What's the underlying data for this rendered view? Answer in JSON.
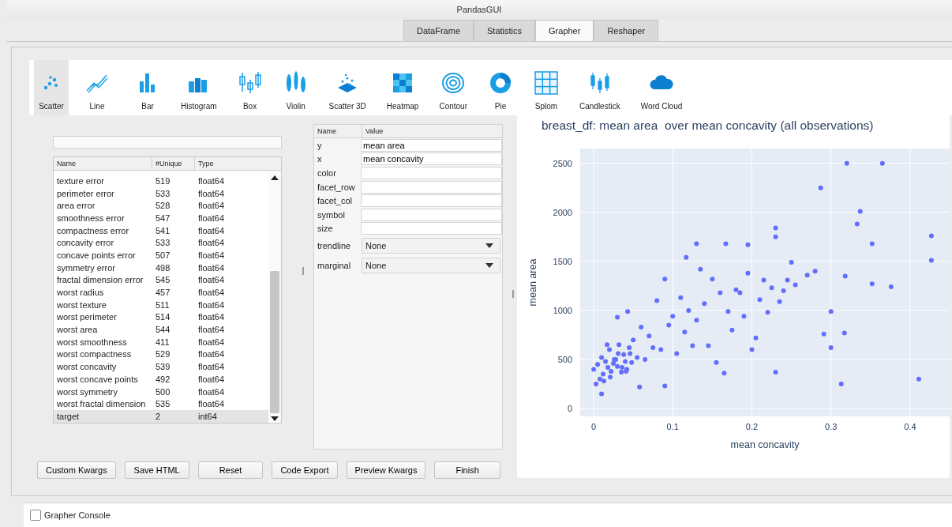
{
  "window": {
    "title": "PandasGUI"
  },
  "tabs": [
    {
      "label": "DataFrame",
      "selected": false
    },
    {
      "label": "Statistics",
      "selected": false
    },
    {
      "label": "Grapher",
      "selected": true
    },
    {
      "label": "Reshaper",
      "selected": false
    }
  ],
  "plot_types": [
    {
      "label": "Scatter",
      "selected": true
    },
    {
      "label": "Line",
      "selected": false
    },
    {
      "label": "Bar",
      "selected": false
    },
    {
      "label": "Histogram",
      "selected": false
    },
    {
      "label": "Box",
      "selected": false
    },
    {
      "label": "Violin",
      "selected": false
    },
    {
      "label": "Scatter 3D",
      "selected": false
    },
    {
      "label": "Heatmap",
      "selected": false
    },
    {
      "label": "Contour",
      "selected": false
    },
    {
      "label": "Pie",
      "selected": false
    },
    {
      "label": "Splom",
      "selected": false
    },
    {
      "label": "Candlestick",
      "selected": false
    },
    {
      "label": "Word Cloud",
      "selected": false
    }
  ],
  "columns_table": {
    "columns": [
      "Name",
      "#Unique",
      "Type"
    ],
    "rows": [
      {
        "name": "texture error",
        "unique": "519",
        "type": "float64",
        "selected": false
      },
      {
        "name": "perimeter error",
        "unique": "533",
        "type": "float64",
        "selected": false
      },
      {
        "name": "area error",
        "unique": "528",
        "type": "float64",
        "selected": false
      },
      {
        "name": "smoothness error",
        "unique": "547",
        "type": "float64",
        "selected": false
      },
      {
        "name": "compactness error",
        "unique": "541",
        "type": "float64",
        "selected": false
      },
      {
        "name": "concavity error",
        "unique": "533",
        "type": "float64",
        "selected": false
      },
      {
        "name": "concave points error",
        "unique": "507",
        "type": "float64",
        "selected": false
      },
      {
        "name": "symmetry error",
        "unique": "498",
        "type": "float64",
        "selected": false
      },
      {
        "name": "fractal dimension error",
        "unique": "545",
        "type": "float64",
        "selected": false
      },
      {
        "name": "worst radius",
        "unique": "457",
        "type": "float64",
        "selected": false
      },
      {
        "name": "worst texture",
        "unique": "511",
        "type": "float64",
        "selected": false
      },
      {
        "name": "worst perimeter",
        "unique": "514",
        "type": "float64",
        "selected": false
      },
      {
        "name": "worst area",
        "unique": "544",
        "type": "float64",
        "selected": false
      },
      {
        "name": "worst smoothness",
        "unique": "411",
        "type": "float64",
        "selected": false
      },
      {
        "name": "worst compactness",
        "unique": "529",
        "type": "float64",
        "selected": false
      },
      {
        "name": "worst concavity",
        "unique": "539",
        "type": "float64",
        "selected": false
      },
      {
        "name": "worst concave points",
        "unique": "492",
        "type": "float64",
        "selected": false
      },
      {
        "name": "worst symmetry",
        "unique": "500",
        "type": "float64",
        "selected": false
      },
      {
        "name": "worst fractal dimension",
        "unique": "535",
        "type": "float64",
        "selected": false
      },
      {
        "name": "target",
        "unique": "2",
        "type": "int64",
        "selected": true
      }
    ]
  },
  "kwargs_table": {
    "columns": [
      "Name",
      "Value"
    ],
    "rows": [
      {
        "name": "y",
        "value": "mean area",
        "kind": "text"
      },
      {
        "name": "x",
        "value": "mean concavity",
        "kind": "text"
      },
      {
        "name": "color",
        "kind": "text"
      },
      {
        "name": "facet_row",
        "kind": "text"
      },
      {
        "name": "facet_col",
        "kind": "text"
      },
      {
        "name": "symbol",
        "kind": "text"
      },
      {
        "name": "size",
        "kind": "text"
      },
      {
        "name": "trendline",
        "value": "None",
        "kind": "dropdown"
      },
      {
        "name": "marginal",
        "value": "None",
        "kind": "dropdown"
      }
    ]
  },
  "chart": {
    "chart_data": {
      "type": "scatter",
      "title": "breast_df: mean area  over mean concavity (all observations)",
      "xlabel": "mean concavity",
      "ylabel": "mean area",
      "x": [
        0,
        0.005,
        0.01,
        0.012,
        0.015,
        0.018,
        0.02,
        0.022,
        0.025,
        0.028,
        0.03,
        0.032,
        0.035,
        0.038,
        0.04,
        0.042,
        0.045,
        0.048,
        0.05,
        0.055,
        0.003,
        0.008,
        0.013,
        0.017,
        0.021,
        0.026,
        0.031,
        0.036,
        0.041,
        0.046,
        0.06,
        0.065,
        0.07,
        0.075,
        0.08,
        0.085,
        0.09,
        0.095,
        0.1,
        0.105,
        0.11,
        0.115,
        0.12,
        0.125,
        0.13,
        0.135,
        0.14,
        0.145,
        0.15,
        0.155,
        0.16,
        0.165,
        0.17,
        0.175,
        0.18,
        0.185,
        0.19,
        0.195,
        0.2,
        0.205,
        0.21,
        0.215,
        0.22,
        0.225,
        0.23,
        0.235,
        0.24,
        0.245,
        0.25,
        0.255,
        0.27,
        0.28,
        0.287,
        0.291,
        0.3,
        0.3,
        0.313,
        0.317,
        0.318,
        0.32,
        0.333,
        0.337,
        0.352,
        0.352,
        0.365,
        0.376,
        0.411,
        0.427,
        0.427,
        0.13,
        0.167,
        0.195,
        0.23,
        0.23,
        0.117,
        0.09,
        0.058,
        0.043,
        0.03,
        0.01
      ],
      "series": [
        {
          "color": "#636efa",
          "values": [
            400,
            450,
            520,
            350,
            480,
            420,
            600,
            380,
            460,
            500,
            430,
            650,
            370,
            550,
            480,
            400,
            620,
            470,
            700,
            520,
            250,
            300,
            280,
            650,
            320,
            500,
            560,
            420,
            380,
            560,
            830,
            500,
            740,
            620,
            1100,
            600,
            1320,
            850,
            940,
            560,
            1130,
            780,
            1000,
            640,
            900,
            1420,
            1070,
            640,
            1320,
            470,
            1180,
            360,
            990,
            800,
            1210,
            1180,
            940,
            1380,
            600,
            720,
            1110,
            1310,
            980,
            1230,
            1840,
            1090,
            1200,
            1310,
            1490,
            1260,
            1360,
            1400,
            2250,
            760,
            990,
            620,
            250,
            770,
            1350,
            2500,
            1880,
            2010,
            1680,
            1270,
            2500,
            1240,
            300,
            1760,
            1510,
            1680,
            1680,
            1670,
            1750,
            370,
            1540,
            230,
            220,
            990,
            930,
            150
          ]
        }
      ],
      "xticks": [
        0,
        0.1,
        0.2,
        0.3,
        0.4
      ],
      "yticks": [
        0,
        500,
        1000,
        1500,
        2000,
        2500
      ],
      "grid": true,
      "xlim": [
        -0.017,
        0.45
      ],
      "ylim": [
        -80,
        2650
      ]
    }
  },
  "buttons": [
    "Custom Kwargs",
    "Save HTML",
    "Reset",
    "Code Export",
    "Preview Kwargs",
    "Finish"
  ],
  "console": {
    "label": "Grapher Console",
    "checked": false
  }
}
